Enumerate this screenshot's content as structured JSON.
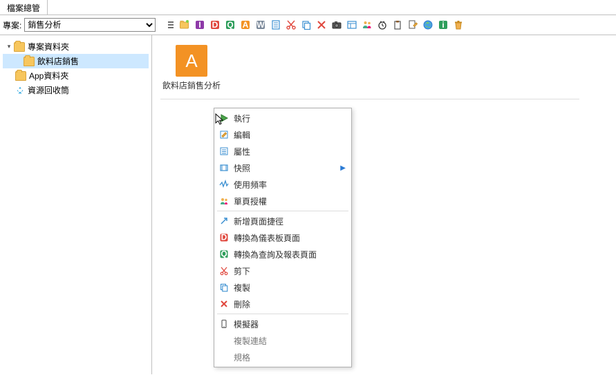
{
  "tab": {
    "title": "檔案總管"
  },
  "toolbar": {
    "project_label": "專案:",
    "project_value": "銷售分析"
  },
  "tree": {
    "root": {
      "label": "專案資料夾"
    },
    "child": {
      "label": "飲料店銷售"
    },
    "apps": {
      "label": "App資料夾"
    },
    "recycle": {
      "label": "資源回收筒"
    }
  },
  "content": {
    "items": [
      {
        "thumb_letter": "A",
        "label": "飲料店銷售分析"
      }
    ]
  },
  "context_menu": {
    "run": "執行",
    "edit": "編輯",
    "properties": "屬性",
    "snapshot": "快照",
    "usage": "使用頻率",
    "single_auth": "單頁授權",
    "new_shortcut": "新增頁面捷徑",
    "to_dashboard": "轉換為儀表板頁面",
    "to_query_report": "轉換為查詢及報表頁面",
    "cut": "剪下",
    "copy": "複製",
    "delete": "刪除",
    "simulator": "模擬器",
    "copy_link": "複製連結",
    "specs": "規格"
  }
}
